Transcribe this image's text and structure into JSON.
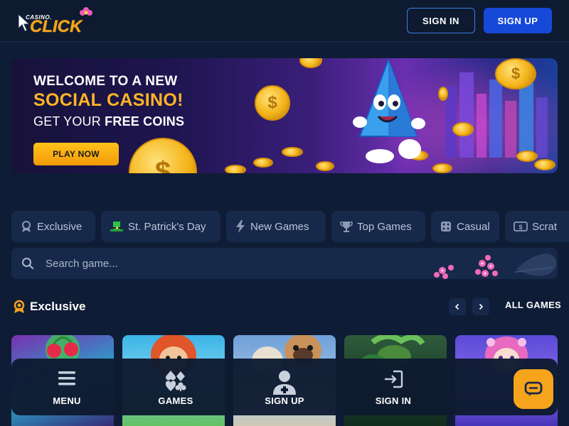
{
  "header": {
    "logo_small": "CASINO.",
    "logo_big": "CLICK",
    "signin_label": "SIGN IN",
    "signup_label": "SIGN UP"
  },
  "banner": {
    "line1": "WELCOME TO A NEW",
    "line2": "SOCIAL CASINO!",
    "line3_a": "GET YOUR ",
    "line3_b": "FREE COINS",
    "play_label": "PLAY NOW"
  },
  "categories": [
    {
      "label": "Exclusive",
      "icon": "badge-icon"
    },
    {
      "label": "St. Patrick's Day",
      "icon": "leprechaun-hat-icon"
    },
    {
      "label": "New Games",
      "icon": "lightning-icon"
    },
    {
      "label": "Top Games",
      "icon": "trophy-icon"
    },
    {
      "label": "Casual",
      "icon": "dice-icon"
    },
    {
      "label": "Scrat",
      "icon": "scratch-card-icon"
    }
  ],
  "search": {
    "placeholder": "Search game..."
  },
  "section": {
    "title": "Exclusive",
    "all_games_label": "ALL GAMES"
  },
  "games": [
    {
      "theme": "fruit-slot",
      "colors": [
        "#7a2fb0",
        "#2aa1c8",
        "#f0b21a"
      ]
    },
    {
      "theme": "leprechaun",
      "colors": [
        "#3ab4e6",
        "#e0552a",
        "#5fbf4a"
      ]
    },
    {
      "theme": "pug",
      "colors": [
        "#6fa0d8",
        "#c9925a",
        "#e8e0d0"
      ]
    },
    {
      "theme": "jungle-snake",
      "colors": [
        "#1a3a2a",
        "#2e7a3a",
        "#6ac05a"
      ]
    },
    {
      "theme": "anime-girl",
      "colors": [
        "#5a4ad8",
        "#e86ac0",
        "#f4c0e8"
      ]
    }
  ],
  "bottom_nav": [
    {
      "label": "MENU",
      "icon": "hamburger-menu-icon"
    },
    {
      "label": "GAMES",
      "icon": "card-suits-icon"
    },
    {
      "label": "SIGN UP",
      "icon": "add-user-icon"
    },
    {
      "label": "SIGN IN",
      "icon": "sign-in-icon"
    }
  ],
  "chat": {
    "icon": "chat-bubble-icon"
  },
  "colors": {
    "background": "#0f1c36",
    "panel": "#17294a",
    "accent_blue": "#1749d8",
    "accent_orange": "#f6a41b"
  }
}
